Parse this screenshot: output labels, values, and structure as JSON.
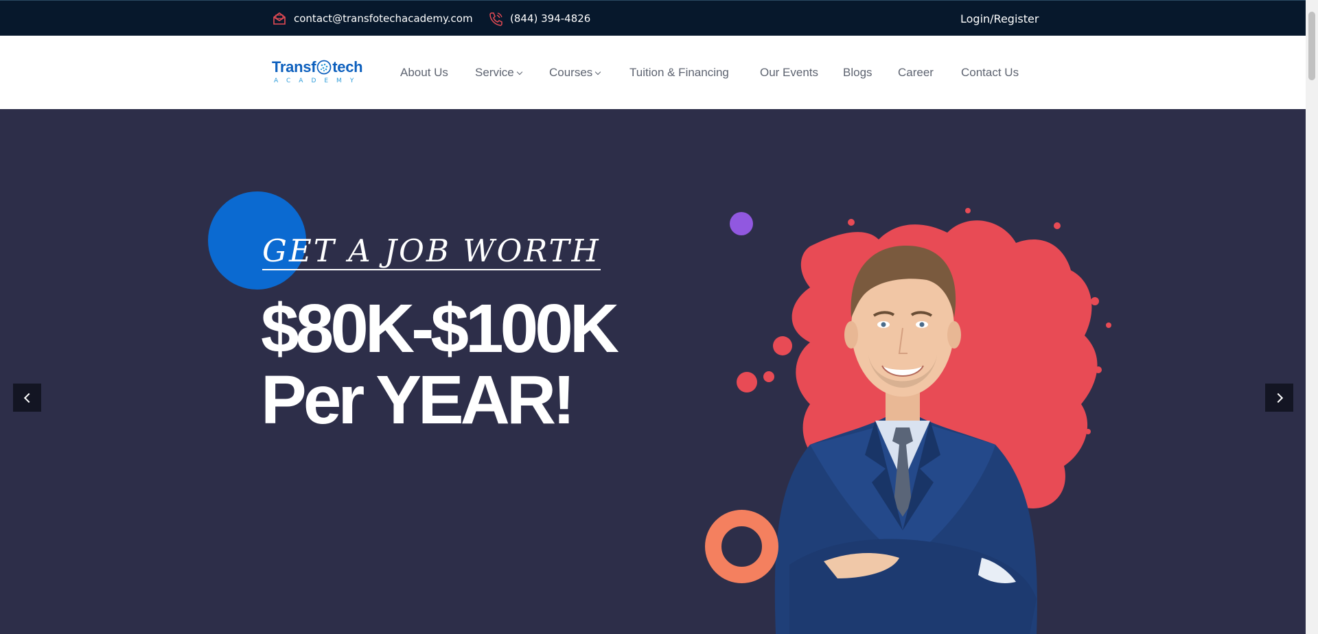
{
  "topbar": {
    "email": "contact@transfotechacademy.com",
    "phone": "(844) 394-4826",
    "login": "Login/Register"
  },
  "logo": {
    "part1": "Transf",
    "part2": "tech",
    "subtitle": "ACADEMY"
  },
  "nav": {
    "items": [
      {
        "label": "About Us"
      },
      {
        "label": "Service"
      },
      {
        "label": "Courses"
      },
      {
        "label": "Tuition & Financing"
      },
      {
        "label": "Our Events"
      },
      {
        "label": "Blogs"
      },
      {
        "label": "Career"
      },
      {
        "label": "Contact Us"
      }
    ]
  },
  "hero": {
    "tagline": "GET A JOB WORTH",
    "headline_line1": "$80K-$100K",
    "headline_line2": "Per YEAR!"
  },
  "colors": {
    "topbar_bg": "#07182c",
    "hero_bg": "#2d2e49",
    "accent_blue": "#0b6ad1",
    "accent_red": "#e84b55",
    "accent_orange": "#f4805f",
    "accent_purple": "#9158e0"
  },
  "icons": {
    "email": "envelope-icon",
    "phone": "phone-icon",
    "prev": "chevron-left-icon",
    "next": "chevron-right-icon"
  }
}
